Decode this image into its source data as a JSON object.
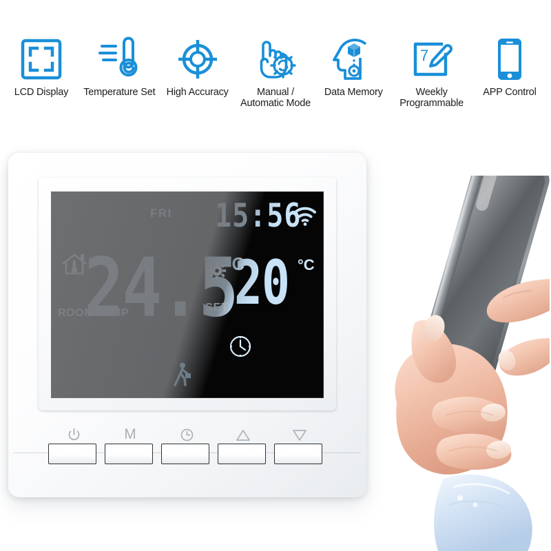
{
  "features": [
    {
      "icon": "lcd-display-icon",
      "label": "LCD Display"
    },
    {
      "icon": "thermometer-icon",
      "label": "Temperature Set"
    },
    {
      "icon": "crosshair-target-icon",
      "label": "High Accuracy"
    },
    {
      "icon": "hand-gear-icon",
      "label": "Manual /\nAutomatic Mode"
    },
    {
      "icon": "head-memory-icon",
      "label": "Data Memory"
    },
    {
      "icon": "calendar-pencil-icon",
      "label": "Weekly\nProgrammable"
    },
    {
      "icon": "smartphone-icon",
      "label": "APP Control"
    }
  ],
  "thermostat": {
    "lcd": {
      "day": "FRI",
      "time": "15:56",
      "wifi_icon": "wifi-icon",
      "home_temp_icon": "house-thermometer-icon",
      "room_temp_label": "ROOM\nTEMP",
      "room_temp_value": "24.5",
      "room_temp_unit": "°C",
      "gear_icon": "gear-icon",
      "set_label": "SET",
      "set_temp_value": "20",
      "set_temp_unit": "°C",
      "clock_icon": "clock-icon",
      "away_icon": "walking-person-icon"
    },
    "buttons": [
      {
        "name": "power-button",
        "glyph": "power-icon"
      },
      {
        "name": "mode-button",
        "glyph": "M"
      },
      {
        "name": "clock-button",
        "glyph": "clock-icon"
      },
      {
        "name": "temp-up-button",
        "glyph": "triangle-up-icon"
      },
      {
        "name": "temp-down-button",
        "glyph": "triangle-down-icon"
      }
    ]
  },
  "colors": {
    "accent_blue": "#1a8fd8",
    "label_text": "#1c1c1c",
    "lcd_segment": "#c8e2f7",
    "lcd_background": "#050505"
  }
}
